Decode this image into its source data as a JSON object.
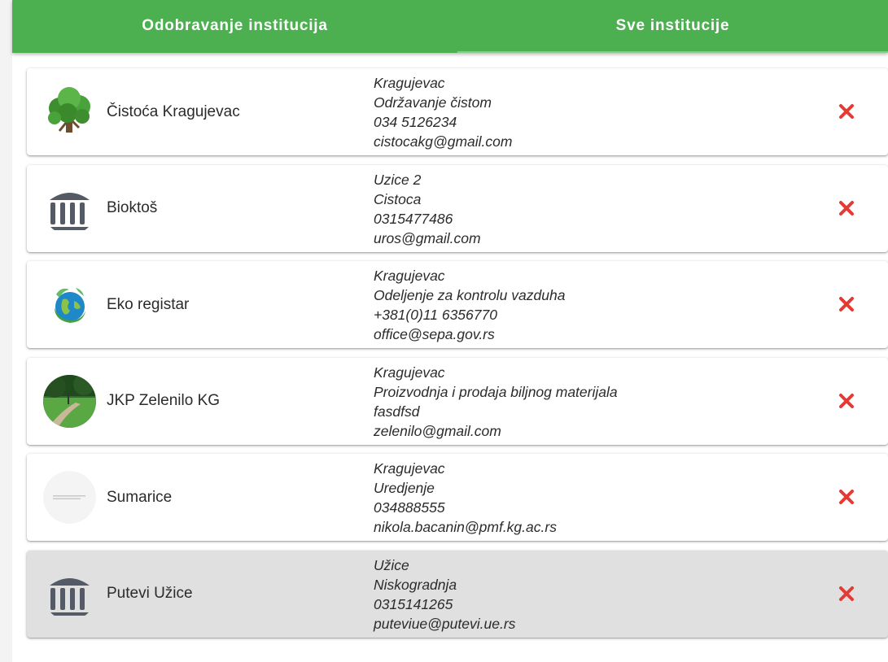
{
  "tabs": {
    "approve_label": "Odobravanje institucija",
    "all_label": "Sve institucije"
  },
  "colors": {
    "primary": "#4caf50",
    "delete": "#e53935",
    "selected_row": "#e0e0e0"
  },
  "institutions": [
    {
      "name": "Čistoća Kragujevac",
      "city": "Kragujevac",
      "type": "Održavanje čistom",
      "phone": "034 5126234",
      "email": "cistocakg@gmail.com",
      "icon": "tree-icon"
    },
    {
      "name": "Bioktoš",
      "city": "Uzice 2",
      "type": "Cistoca",
      "phone": "0315477486",
      "email": "uros@gmail.com",
      "icon": "institution-icon"
    },
    {
      "name": "Eko registar",
      "city": "Kragujevac",
      "type": "Odeljenje za kontrolu vazduha",
      "phone": "+381(0)11 6356770",
      "email": "office@sepa.gov.rs",
      "icon": "eco-globe-icon"
    },
    {
      "name": "JKP Zelenilo KG",
      "city": "Kragujevac",
      "type": "Proizvodnja i prodaja biljnog materijala",
      "phone": "fasdfsd",
      "email": "zelenilo@gmail.com",
      "icon": "park-photo-icon"
    },
    {
      "name": "Sumarice",
      "city": "Kragujevac",
      "type": "Uredjenje",
      "phone": "034888555",
      "email": "nikola.bacanin@pmf.kg.ac.rs",
      "icon": "placeholder-logo-icon"
    },
    {
      "name": "Putevi Užice",
      "city": "Užice",
      "type": "Niskogradnja",
      "phone": "0315141265",
      "email": "puteviue@putevi.ue.rs",
      "icon": "institution-icon",
      "selected": true
    }
  ]
}
